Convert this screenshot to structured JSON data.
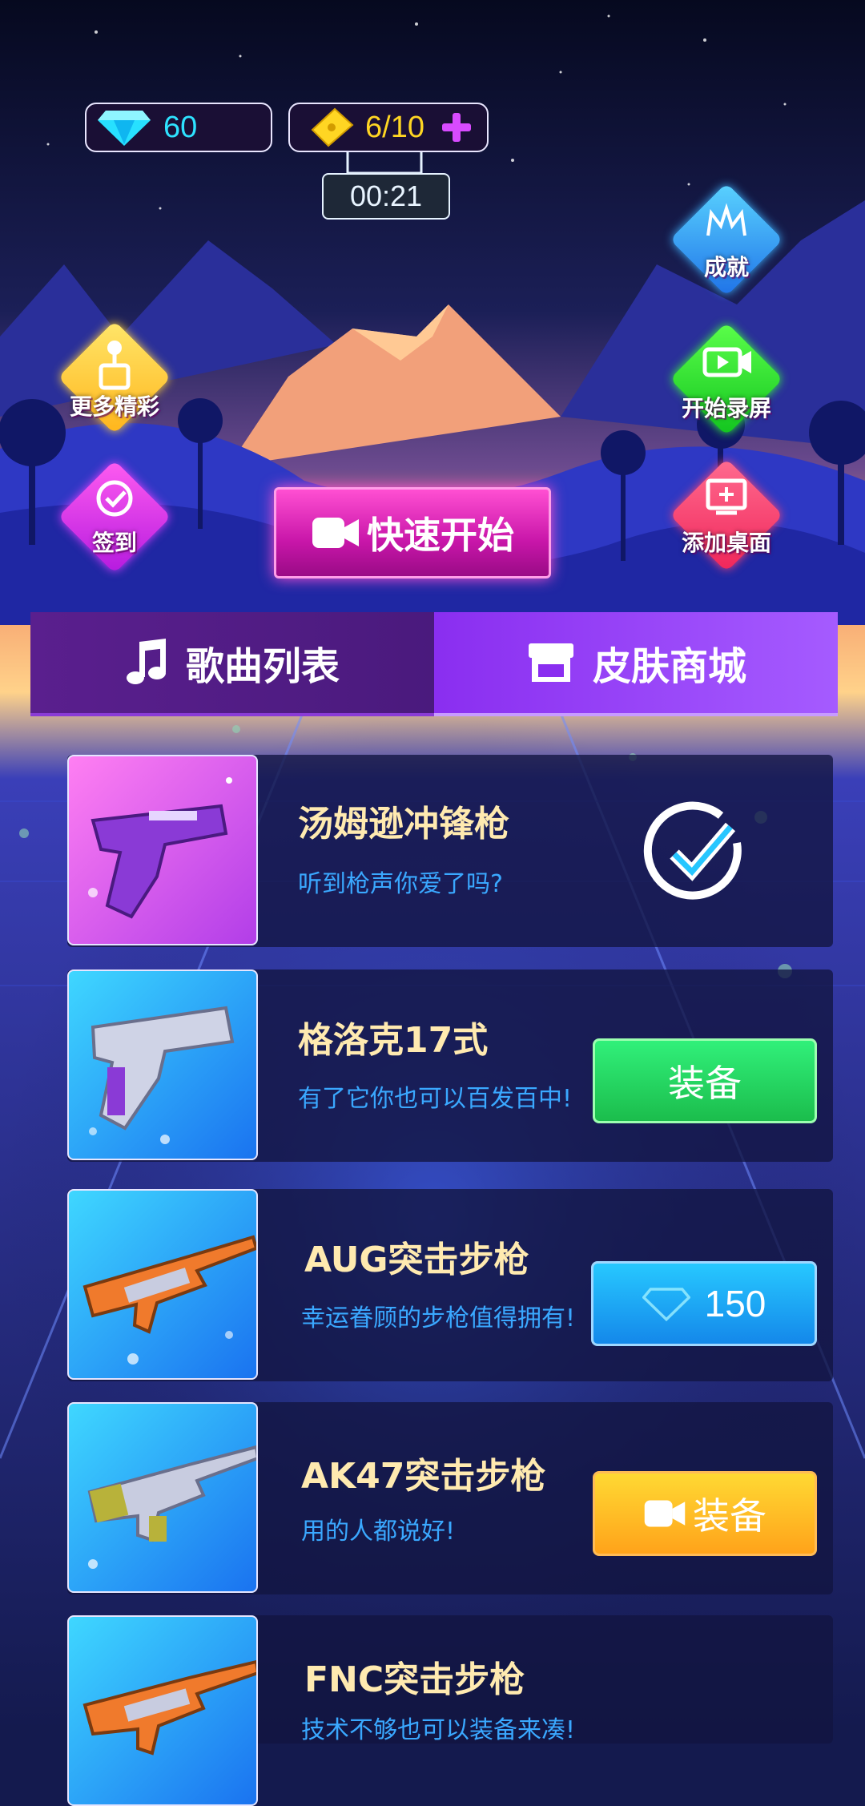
{
  "hud": {
    "diamonds": "60",
    "tickets": "6/10",
    "timer": "00:21"
  },
  "side_buttons": {
    "more": "更多精彩",
    "checkin": "签到",
    "achievement": "成就",
    "record": "开始录屏",
    "desktop": "添加桌面"
  },
  "quick_start": "快速开始",
  "tabs": [
    {
      "label": "歌曲列表",
      "active": false
    },
    {
      "label": "皮肤商城",
      "active": true
    }
  ],
  "items": [
    {
      "name": "汤姆逊冲锋枪",
      "desc": "听到枪声你爱了吗?",
      "status": "equipped"
    },
    {
      "name": "格洛克17式",
      "desc": "有了它你也可以百发百中!",
      "button": "装备"
    },
    {
      "name": "AUG突击步枪",
      "desc": "幸运眷顾的步枪值得拥有!",
      "price": "150"
    },
    {
      "name": "AK47突击步枪",
      "desc": "用的人都说好!",
      "button": "装备"
    },
    {
      "name": "FNC突击步枪",
      "desc": "技术不够也可以装备来凑!"
    }
  ],
  "colors": {
    "accent_pink": "#ff4fd2",
    "tab_active": "#a55bff",
    "name_text": "#ffeab0",
    "desc_text": "#3aa8ff"
  }
}
